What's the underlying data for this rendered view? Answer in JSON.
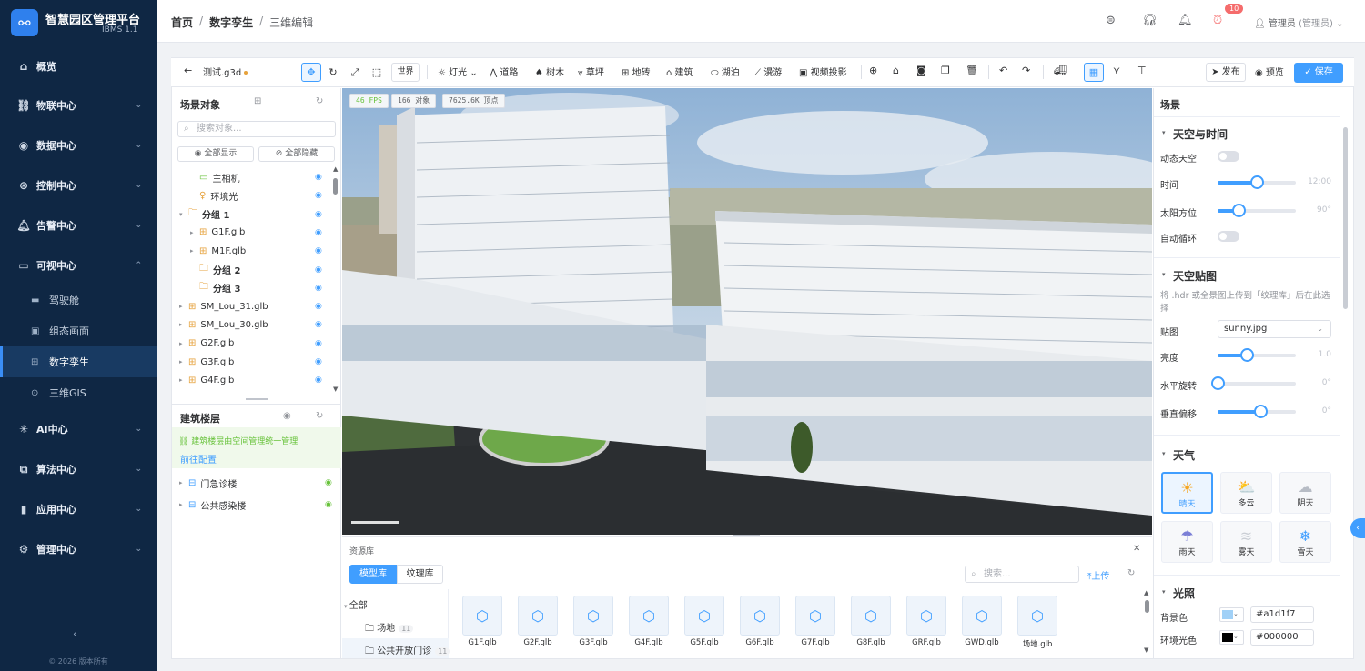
{
  "app": {
    "title": "智慧园区管理平台",
    "version": "IBMS 1.1",
    "copyright": "© 2026 版本所有"
  },
  "sidebar": {
    "items": [
      {
        "label": "概览",
        "icon": "home-icon"
      },
      {
        "label": "物联中心",
        "icon": "link-icon"
      },
      {
        "label": "数据中心",
        "icon": "data-icon"
      },
      {
        "label": "控制中心",
        "icon": "control-icon"
      },
      {
        "label": "告警中心",
        "icon": "bell-icon"
      },
      {
        "label": "可视中心",
        "icon": "monitor-icon"
      },
      {
        "label": "AI中心",
        "icon": "ai-icon"
      },
      {
        "label": "算法中心",
        "icon": "algorithm-icon"
      },
      {
        "label": "应用中心",
        "icon": "app-icon"
      },
      {
        "label": "管理中心",
        "icon": "gear-icon"
      }
    ],
    "sub_items": [
      {
        "label": "驾驶舱",
        "icon": "cockpit-icon"
      },
      {
        "label": "组态画面",
        "icon": "image-icon"
      },
      {
        "label": "数字孪生",
        "icon": "twin-icon",
        "active": true
      },
      {
        "label": "三维GIS",
        "icon": "location-icon"
      }
    ]
  },
  "header": {
    "breadcrumb": [
      "首页",
      "数字孪生",
      "三维编辑"
    ],
    "alarm_count": "10",
    "user": "管理员",
    "role": "(管理员)"
  },
  "toolbar": {
    "file_name": "测试.g3d",
    "world": "世界",
    "tools": [
      "灯光",
      "道路",
      "树木",
      "草坪",
      "地砖",
      "建筑",
      "湖泊",
      "漫游",
      "视频投影"
    ],
    "publish": "发布",
    "preview": "预览",
    "save": "保存"
  },
  "scene_objects": {
    "title": "场景对象",
    "search_placeholder": "搜索对象...",
    "show_all": "全部显示",
    "hide_all": "全部隐藏",
    "tree": [
      {
        "label": "主相机",
        "icon": "camera-icon",
        "level": 1
      },
      {
        "label": "环境光",
        "icon": "light-icon",
        "level": 1
      },
      {
        "label": "分组 1",
        "icon": "folder-icon",
        "level": 0,
        "expand": true,
        "bold": true
      },
      {
        "label": "G1F.glb",
        "icon": "model-icon",
        "level": 1,
        "expand": true
      },
      {
        "label": "M1F.glb",
        "icon": "model-icon",
        "level": 1,
        "expand": true
      },
      {
        "label": "分组 2",
        "icon": "folder-icon",
        "level": 1,
        "bold": true
      },
      {
        "label": "分组 3",
        "icon": "folder-icon",
        "level": 1,
        "bold": true
      },
      {
        "label": "SM_Lou_31.glb",
        "icon": "model-icon",
        "level": 0,
        "expand": true
      },
      {
        "label": "SM_Lou_30.glb",
        "icon": "model-icon",
        "level": 0,
        "expand": true
      },
      {
        "label": "G2F.glb",
        "icon": "model-icon",
        "level": 0,
        "expand": true
      },
      {
        "label": "G3F.glb",
        "icon": "model-icon",
        "level": 0,
        "expand": true
      },
      {
        "label": "G4F.glb",
        "icon": "model-icon",
        "level": 0,
        "expand": true
      }
    ]
  },
  "building_floors": {
    "title": "建筑楼层",
    "tip": "建筑楼层由空间管理统一管理",
    "link": "前往配置",
    "items": [
      "门急诊楼",
      "公共感染楼"
    ]
  },
  "viewport": {
    "fps": "46",
    "fps_unit": "FPS",
    "objects": "166",
    "objects_unit": "对象",
    "vertices": "7625.6K",
    "vertices_unit": "顶点"
  },
  "assets": {
    "title": "资源库",
    "tabs": [
      "模型库",
      "纹理库"
    ],
    "search_placeholder": "搜索...",
    "upload": "上传",
    "categories": [
      {
        "label": "全部",
        "count": ""
      },
      {
        "label": "场地",
        "count": "11"
      },
      {
        "label": "公共开放门诊",
        "count": "11"
      }
    ],
    "items": [
      "G1F.glb",
      "G2F.glb",
      "G3F.glb",
      "G4F.glb",
      "G5F.glb",
      "G6F.glb",
      "G7F.glb",
      "G8F.glb",
      "GRF.glb",
      "GWD.glb",
      "场地.glb"
    ]
  },
  "scene_panel": {
    "title": "场景",
    "sky_time": {
      "title": "天空与时间",
      "dynamic_sky": "动态天空",
      "time_label": "时间",
      "time_value": "12:00",
      "time_fraction": 0.5,
      "sun_label": "太阳方位",
      "sun_value": "90°",
      "sun_fraction": 0.27,
      "auto_cycle": "自动循环"
    },
    "sky_map": {
      "title": "天空贴图",
      "tip": "将 .hdr 或全景图上传到「纹理库」后在此选择",
      "map_label": "贴图",
      "map_value": "sunny.jpg",
      "brightness_label": "亮度",
      "brightness_value": "1.0",
      "brightness_fraction": 0.37,
      "rotation_label": "水平旋转",
      "rotation_value": "0°",
      "rotation_fraction": 0.0,
      "offset_label": "垂直偏移",
      "offset_value": "0°",
      "offset_fraction": 0.55
    },
    "weather": {
      "title": "天气",
      "options": [
        "晴天",
        "多云",
        "阴天",
        "雨天",
        "雾天",
        "雪天"
      ],
      "selected": "晴天"
    },
    "lighting": {
      "title": "光照",
      "bg_label": "背景色",
      "bg_value": "#a1d1f7",
      "ambient_label": "环境光色",
      "ambient_value": "#000000"
    }
  }
}
